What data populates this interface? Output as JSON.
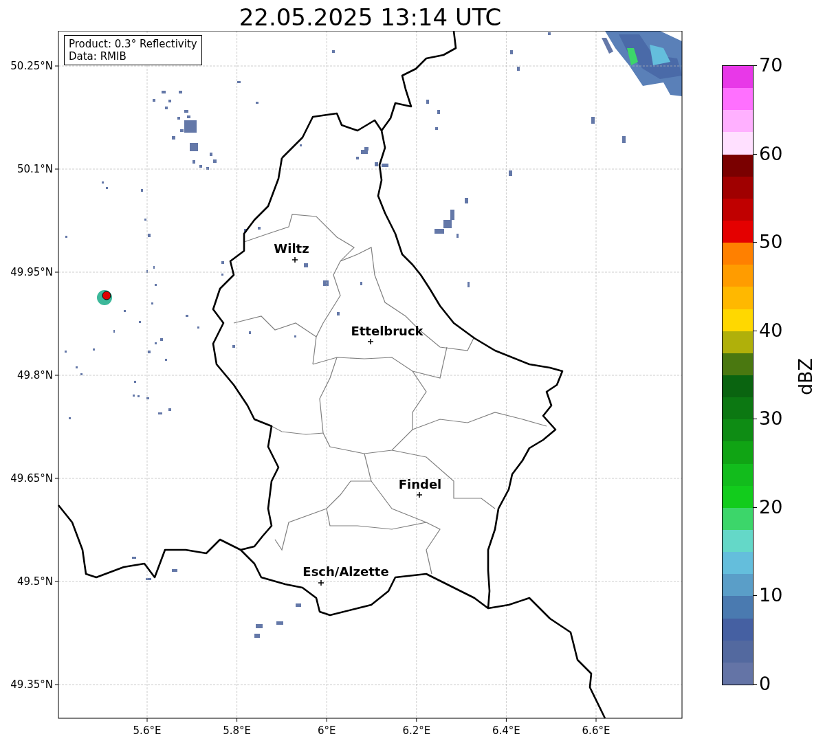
{
  "title": "22.05.2025 13:14 UTC",
  "info_box": {
    "lines": [
      "Product: 0.3° Reflectivity",
      "Data: RMIB"
    ]
  },
  "map": {
    "lat_ticks": [
      "50.25°N",
      "50.1°N",
      "49.95°N",
      "49.8°N",
      "49.65°N",
      "49.5°N",
      "49.35°N"
    ],
    "lon_ticks": [
      "5.6°E",
      "5.8°E",
      "6°E",
      "6.2°E",
      "6.4°E",
      "6.6°E"
    ],
    "cities": [
      {
        "name": "Wiltz"
      },
      {
        "name": "Ettelbruck"
      },
      {
        "name": "Findel"
      },
      {
        "name": "Esch/Alzette"
      }
    ]
  },
  "colorbar": {
    "label": "dBZ",
    "ticks": [
      "70",
      "60",
      "50",
      "40",
      "30",
      "20",
      "10",
      "0"
    ],
    "segments": [
      {
        "color": "#e838e8"
      },
      {
        "color": "#ff70ff"
      },
      {
        "color": "#ffb0ff"
      },
      {
        "color": "#ffe0ff"
      },
      {
        "color": "#7a0000"
      },
      {
        "color": "#a00000"
      },
      {
        "color": "#c00000"
      },
      {
        "color": "#e40000"
      },
      {
        "color": "#ff8000"
      },
      {
        "color": "#ff9c00"
      },
      {
        "color": "#ffb800"
      },
      {
        "color": "#ffd800"
      },
      {
        "color": "#b0b00a"
      },
      {
        "color": "#4a7810"
      },
      {
        "color": "#0a6410"
      },
      {
        "color": "#0c7812"
      },
      {
        "color": "#0e8c14"
      },
      {
        "color": "#10a414"
      },
      {
        "color": "#12bc1c"
      },
      {
        "color": "#12cc1c"
      },
      {
        "color": "#3cd66a"
      },
      {
        "color": "#64d8c8"
      },
      {
        "color": "#64bedc"
      },
      {
        "color": "#5a9ec8"
      },
      {
        "color": "#4a7ab0"
      },
      {
        "color": "#4560a2"
      },
      {
        "color": "#53699f"
      },
      {
        "color": "#6474a6"
      }
    ]
  }
}
